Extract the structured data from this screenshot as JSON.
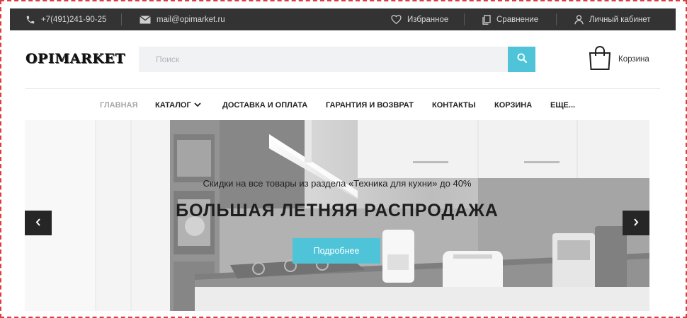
{
  "topbar": {
    "phone": "+7(491)241-90-25",
    "email": "mail@opimarket.ru",
    "favorites": "Избранное",
    "compare": "Сравнение",
    "account": "Личный кабинет"
  },
  "header": {
    "logo": "OPIMARKET",
    "search_placeholder": "Поиск",
    "cart": "Корзина"
  },
  "nav": {
    "items": [
      "ГЛАВНАЯ",
      "КАТАЛОГ",
      "ДОСТАВКА И ОПЛАТА",
      "ГАРАНТИЯ И ВОЗВРАТ",
      "КОНТАКТЫ",
      "КОРЗИНА",
      "ЕЩЕ..."
    ]
  },
  "banner": {
    "subtitle": "Скидки на все товары из раздела «Техника для кухни» до 40%",
    "headline": "БОЛЬШАЯ ЛЕТНЯЯ РАСПРОДАЖА",
    "cta": "Подробнее"
  },
  "icons": {
    "phone": "phone-icon",
    "email": "envelope-icon",
    "favorites": "heart-icon",
    "compare": "compare-icon",
    "account": "user-icon",
    "search": "search-icon",
    "cart": "shopping-bag-icon",
    "catalog_dropdown": "chevron-down-icon",
    "prev": "chevron-left-icon",
    "next": "chevron-right-icon"
  },
  "colors": {
    "accent": "#4fc4d9",
    "topbar": "#333333",
    "frame": "#e03c3c"
  }
}
